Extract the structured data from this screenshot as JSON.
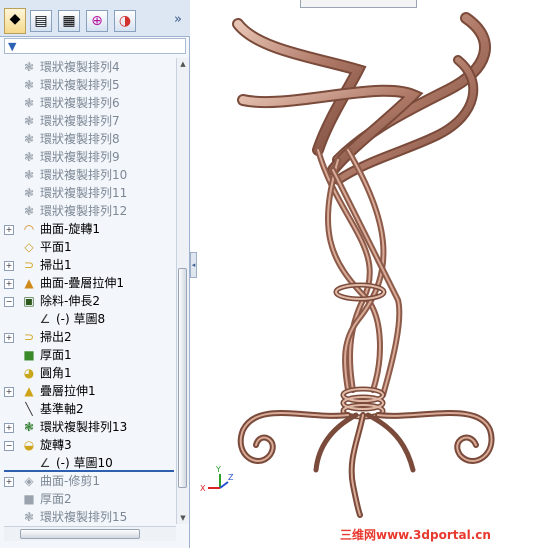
{
  "tabs": [
    {
      "icon": "feature-manager-icon",
      "glyph": "◆"
    },
    {
      "icon": "property-manager-icon",
      "glyph": "▤"
    },
    {
      "icon": "configuration-manager-icon",
      "glyph": "▦"
    },
    {
      "icon": "dimxpert-icon",
      "glyph": "⊕"
    },
    {
      "icon": "display-manager-icon",
      "glyph": "◑"
    }
  ],
  "collapse_glyph": "»",
  "filter_glyph": "▼",
  "tree_items": [
    {
      "label": "環狀複製排列4",
      "icon": "circular-pattern-icon",
      "glyph": "❃",
      "state": "dim",
      "indent": 1,
      "expander": ""
    },
    {
      "label": "環狀複製排列5",
      "icon": "circular-pattern-icon",
      "glyph": "❃",
      "state": "dim",
      "indent": 1,
      "expander": ""
    },
    {
      "label": "環狀複製排列6",
      "icon": "circular-pattern-icon",
      "glyph": "❃",
      "state": "dim",
      "indent": 1,
      "expander": ""
    },
    {
      "label": "環狀複製排列7",
      "icon": "circular-pattern-icon",
      "glyph": "❃",
      "state": "dim",
      "indent": 1,
      "expander": ""
    },
    {
      "label": "環狀複製排列8",
      "icon": "circular-pattern-icon",
      "glyph": "❃",
      "state": "dim",
      "indent": 1,
      "expander": ""
    },
    {
      "label": "環狀複製排列9",
      "icon": "circular-pattern-icon",
      "glyph": "❃",
      "state": "dim",
      "indent": 1,
      "expander": ""
    },
    {
      "label": "環狀複製排列10",
      "icon": "circular-pattern-icon",
      "glyph": "❃",
      "state": "dim",
      "indent": 1,
      "expander": ""
    },
    {
      "label": "環狀複製排列11",
      "icon": "circular-pattern-icon",
      "glyph": "❃",
      "state": "dim",
      "indent": 1,
      "expander": ""
    },
    {
      "label": "環狀複製排列12",
      "icon": "circular-pattern-icon",
      "glyph": "❃",
      "state": "dim",
      "indent": 1,
      "expander": ""
    },
    {
      "label": "曲面-旋轉1",
      "icon": "revolved-surface-icon",
      "glyph": "◠",
      "state": "norm",
      "indent": 1,
      "expander": "+"
    },
    {
      "label": "平面1",
      "icon": "plane-icon",
      "glyph": "◇",
      "state": "norm",
      "indent": 1,
      "expander": ""
    },
    {
      "label": "掃出1",
      "icon": "sweep-icon",
      "glyph": "⊃",
      "state": "norm",
      "indent": 1,
      "expander": "+"
    },
    {
      "label": "曲面-疊層拉伸1",
      "icon": "lofted-surface-icon",
      "glyph": "▲",
      "state": "norm",
      "indent": 1,
      "expander": "+"
    },
    {
      "label": "除料-伸長2",
      "icon": "cut-extrude-icon",
      "glyph": "▣",
      "state": "norm",
      "indent": 1,
      "expander": "−"
    },
    {
      "label": "(-) 草圖8",
      "icon": "sketch-icon",
      "glyph": "∠",
      "state": "norm",
      "indent": 2,
      "expander": ""
    },
    {
      "label": "掃出2",
      "icon": "sweep-icon",
      "glyph": "⊃",
      "state": "norm",
      "indent": 1,
      "expander": "+"
    },
    {
      "label": "厚面1",
      "icon": "thicken-icon",
      "glyph": "■",
      "state": "norm",
      "indent": 1,
      "expander": ""
    },
    {
      "label": "圓角1",
      "icon": "fillet-icon",
      "glyph": "◕",
      "state": "norm",
      "indent": 1,
      "expander": ""
    },
    {
      "label": "疊層拉伸1",
      "icon": "loft-icon",
      "glyph": "▲",
      "state": "norm",
      "indent": 1,
      "expander": "+"
    },
    {
      "label": "基準軸2",
      "icon": "axis-icon",
      "glyph": "╲",
      "state": "norm",
      "indent": 1,
      "expander": ""
    },
    {
      "label": "環狀複製排列13",
      "icon": "circular-pattern-icon",
      "glyph": "❃",
      "state": "norm",
      "indent": 1,
      "expander": "+"
    },
    {
      "label": "旋轉3",
      "icon": "revolve-icon",
      "glyph": "◒",
      "state": "norm",
      "indent": 1,
      "expander": "−"
    },
    {
      "label": "(-) 草圖10",
      "icon": "sketch-icon",
      "glyph": "∠",
      "state": "norm",
      "indent": 2,
      "expander": ""
    },
    {
      "label": "曲面-修剪1",
      "icon": "trim-surface-icon",
      "glyph": "◈",
      "state": "dim",
      "indent": 1,
      "expander": "+"
    },
    {
      "label": "厚面2",
      "icon": "thicken-icon",
      "glyph": "■",
      "state": "dim",
      "indent": 1,
      "expander": ""
    },
    {
      "label": "環狀複製排列15",
      "icon": "circular-pattern-icon",
      "glyph": "❃",
      "state": "dim",
      "indent": 1,
      "expander": ""
    }
  ],
  "scroll_up": "▲",
  "scroll_down": "▼",
  "splitter_glyph": "◂",
  "triad": {
    "x": "X",
    "y": "Y",
    "z": "Z"
  },
  "watermark": "三维网www.3dportal.cn",
  "colors": {
    "model": "#b07a68",
    "model_shade": "#7a4a3a",
    "model_light": "#e8c4b4",
    "rollback": "#2d5fae",
    "watermark": "#e8392e"
  }
}
